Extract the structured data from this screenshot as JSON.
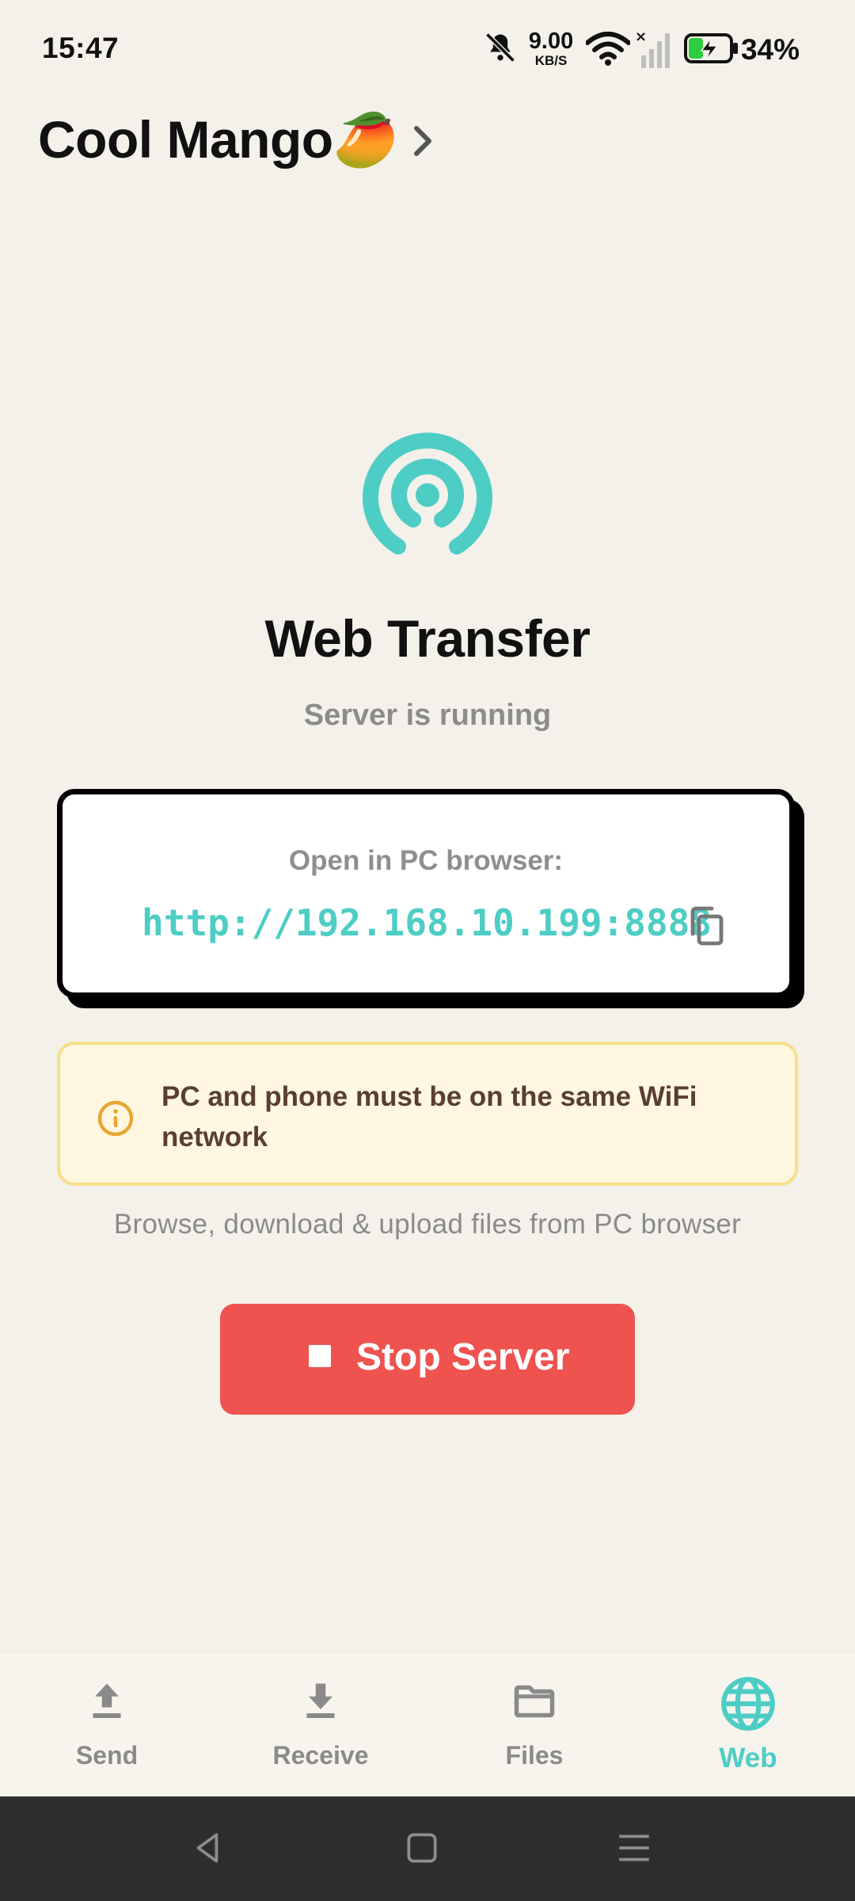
{
  "status_bar": {
    "time": "15:47",
    "net_speed_value": "9.00",
    "net_speed_unit": "KB/S",
    "battery_percent": "34%"
  },
  "header": {
    "title": "Cool Mango🥭"
  },
  "main": {
    "title": "Web Transfer",
    "status": "Server is running",
    "card": {
      "label": "Open in PC browser:",
      "url": "http://192.168.10.199:8888"
    },
    "info": {
      "text": "PC and phone must be on the same WiFi network"
    },
    "hint": "Browse, download & upload files from PC browser",
    "stop_button": {
      "label": "Stop Server"
    }
  },
  "bottom_nav": {
    "items": [
      {
        "label": "Send",
        "icon": "upload-icon",
        "active": false
      },
      {
        "label": "Receive",
        "icon": "download-icon",
        "active": false
      },
      {
        "label": "Files",
        "icon": "folder-icon",
        "active": false
      },
      {
        "label": "Web",
        "icon": "globe-icon",
        "active": true
      }
    ]
  },
  "colors": {
    "background": "#F4F1EA",
    "accent": "#4ECDC4",
    "danger": "#EE5350",
    "info_bg": "#FFF7DF",
    "info_border": "#F7DF8C",
    "info_icon": "#E8A531"
  }
}
